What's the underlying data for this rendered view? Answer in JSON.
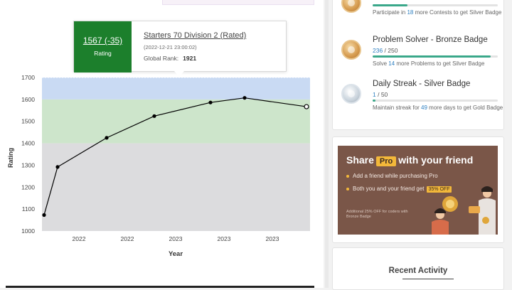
{
  "tooltip": {
    "rating_value": "1567 (-35)",
    "rating_label": "Rating",
    "contest_name": "Starters 70 Division 2 (Rated)",
    "contest_date": "(2022-12-21 23:00:02)",
    "global_rank_label": "Global Rank:",
    "global_rank_value": "1921"
  },
  "badges": [
    {
      "name": "",
      "count_current": "",
      "count_total": "",
      "progress": 0.28,
      "desc_pre": "Participate in ",
      "desc_num": "18",
      "desc_post": " more Contests to get Silver Badge",
      "medal": "bronze"
    },
    {
      "name": "Problem Solver - Bronze Badge",
      "count_current": "236",
      "count_total": " / 250",
      "progress": 0.944,
      "desc_pre": "Solve ",
      "desc_num": "14",
      "desc_post": " more Problems to get Silver Badge",
      "medal": "bronze"
    },
    {
      "name": "Daily Streak - Silver Badge",
      "count_current": "1",
      "count_total": " / 50",
      "progress": 0.02,
      "desc_pre": "Maintain streak for ",
      "desc_num": "49",
      "desc_post": " more days to get Gold Badge",
      "medal": "silver"
    }
  ],
  "promo": {
    "title_pre": "Share",
    "title_chip": "Pro",
    "title_post": "with your friend",
    "line1": "Add a friend while purchasing Pro",
    "line2": "Both you and your friend get",
    "line2_chip": "35% OFF",
    "small": "Additional 25% OFF for coders with Bronze Badge",
    "bg_color": "#7a5648",
    "accent": "#f3b83a"
  },
  "recent_activity": {
    "title": "Recent Activity"
  },
  "chart_data": {
    "type": "line",
    "xlabel": "Year",
    "ylabel": "Rating",
    "x_tick_labels": [
      "2022",
      "2022",
      "2023",
      "2023",
      "2023"
    ],
    "y_ticks": [
      1000,
      1100,
      1200,
      1300,
      1400,
      1500,
      1600,
      1700
    ],
    "ylim": [
      1000,
      1700
    ],
    "bands": [
      {
        "from": 1000,
        "to": 1400,
        "color": "#dcdcde"
      },
      {
        "from": 1400,
        "to": 1600,
        "color": "#cde5cb"
      },
      {
        "from": 1600,
        "to": 1700,
        "color": "#c9daf3"
      }
    ],
    "points": [
      1073,
      1292,
      1425,
      1524,
      1586,
      1607,
      1567
    ],
    "highlight_index": 6,
    "line_color": "#000000"
  }
}
